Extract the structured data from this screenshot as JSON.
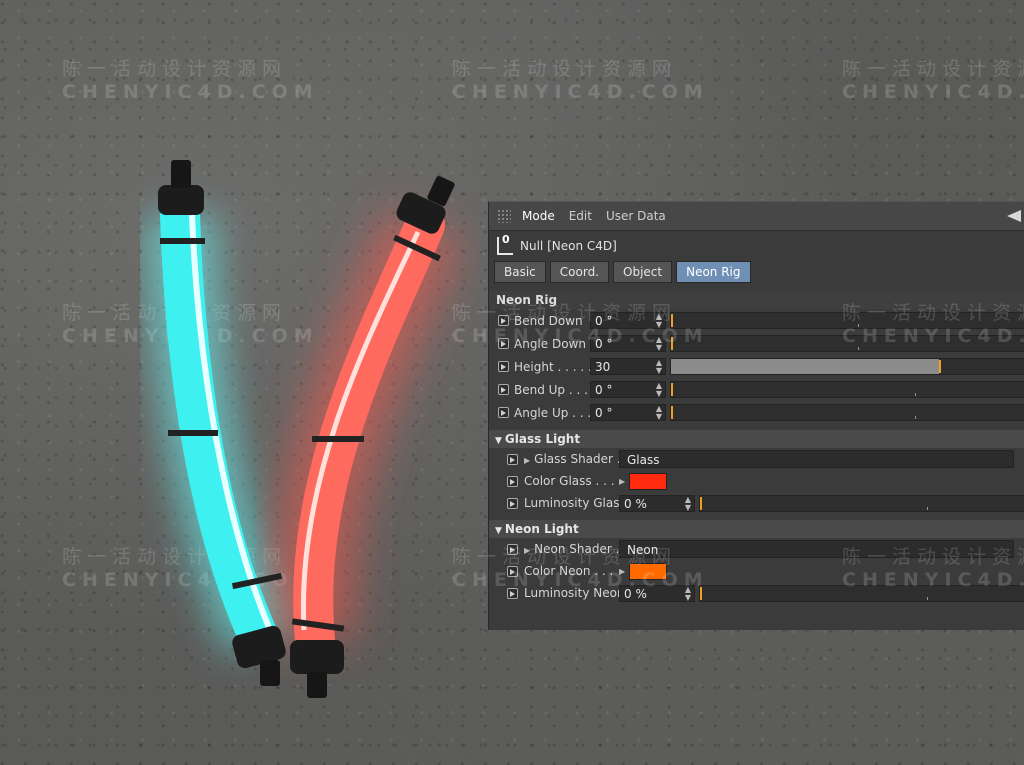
{
  "watermarks": [
    {
      "cn": "陈一活动设计资源网",
      "en": "CHENYIC4D.COM"
    },
    {
      "cn": "陈一活动设计资源网",
      "en": "CHENYIC4D.COM"
    },
    {
      "cn": "陈一活动设计资源网",
      "en": "CHENYIC4D.COM"
    },
    {
      "cn": "陈一活动设计资源网",
      "en": "CHENYIC4D.COM"
    },
    {
      "cn": "陈一活动设计资源网",
      "en": "CHENYIC4D.COM"
    },
    {
      "cn": "陈一活动设计资源网",
      "en": "CHENYIC4D.COM"
    },
    {
      "cn": "陈一活动设计资源网",
      "en": "CHENYIC4D.COM"
    },
    {
      "cn": "陈一活动设计资源网",
      "en": "CHENYIC4D.COM"
    },
    {
      "cn": "陈一活动设计资源网",
      "en": "CHENYIC4D.COM"
    }
  ],
  "tubes": {
    "left_color": "#3ff0f0",
    "right_color": "#ff5f55"
  },
  "panel": {
    "menu": [
      "Mode",
      "Edit",
      "User Data"
    ],
    "object_title": "Null [Neon C4D]",
    "null_icon_letter": "0",
    "tabs": [
      "Basic",
      "Coord.",
      "Object",
      "Neon Rig"
    ],
    "selected_tab": "Neon Rig",
    "section_title": "Neon Rig",
    "params": [
      {
        "label": "Bend Down",
        "value": "0 °",
        "fill": 0.0
      },
      {
        "label": "Angle Down",
        "value": "0 °",
        "fill": 0.0
      },
      {
        "label": "Height . . . . .",
        "value": "30",
        "fill": 0.76
      },
      {
        "label": "Bend Up . . . .",
        "value": "0 °",
        "fill": 0.0
      },
      {
        "label": "Angle Up . . . .",
        "value": "0 °",
        "fill": 0.0
      }
    ],
    "glass_group": {
      "title": "Glass Light",
      "shader_label": "Glass Shader . .",
      "shader_value": "Glass",
      "color_label": "Color Glass . . .",
      "color": "#ff2a10",
      "lum_label": "Luminosity Glass",
      "lum_value": "0 %",
      "lum_fill": 0.0
    },
    "neon_group": {
      "title": "Neon Light",
      "shader_label": "Neon Shader . .",
      "shader_value": "Neon",
      "color_label": "Color Neon . . .",
      "color": "#ff6a00",
      "lum_label": "Luminosity Neon",
      "lum_value": "0 %",
      "lum_fill": 0.0
    }
  }
}
